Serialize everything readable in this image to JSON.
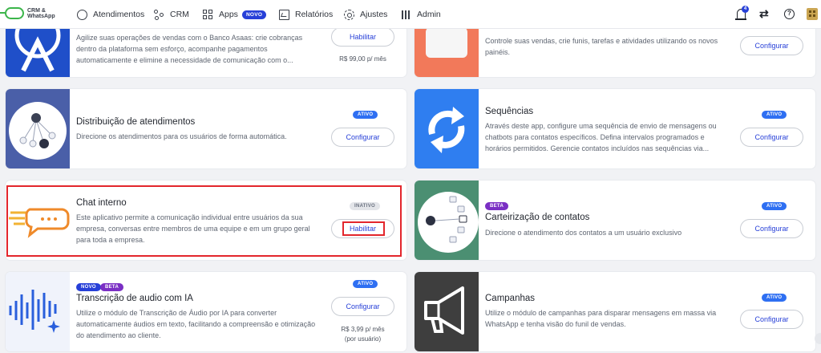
{
  "brand": {
    "logo_text": "CRM & WhatsApp"
  },
  "nav": {
    "atendimentos": "Atendimentos",
    "crm": "CRM",
    "apps": "Apps",
    "apps_badge": "NOVO",
    "relatorios": "Relatórios",
    "ajustes": "Ajustes",
    "admin": "Admin"
  },
  "header_icons": {
    "notifications_count": "4",
    "swap_glyph": "⇄",
    "help_glyph": "?"
  },
  "colors": {
    "brand_blue": "#2740d8",
    "active_blue": "#2e6ff2",
    "highlight_red": "#e3262c",
    "beta_purple": "#7a2fc4"
  },
  "cards": {
    "asaas": {
      "desc": "Agilize suas operações de vendas com o Banco Asaas: crie cobranças dentro da plataforma sem esforço, acompanhe pagamentos automaticamente e elimine a necessidade de comunicação com o...",
      "button": "Habilitar",
      "price": "R$ 99,00 p/ mês"
    },
    "funil": {
      "desc": "Controle suas vendas, crie funis, tarefas e atividades utilizando os novos painéis.",
      "button": "Configurar"
    },
    "distribuicao": {
      "title": "Distribuição de atendimentos",
      "desc": "Direcione os atendimentos para os usuários de forma automática.",
      "status": "ATIVO",
      "button": "Configurar"
    },
    "sequencias": {
      "title": "Sequências",
      "desc": "Através deste app, configure uma sequência de envio de mensagens ou chatbots para contatos específicos. Defina intervalos programados e horários permitidos. Gerencie contatos incluídos nas sequências via...",
      "status": "ATIVO",
      "button": "Configurar"
    },
    "chat_interno": {
      "title": "Chat interno",
      "desc": "Este aplicativo permite a comunicação individual entre usuários da sua empresa, conversas entre membros de uma equipe e em um grupo geral para toda a empresa.",
      "status": "INATIVO",
      "button": "Habilitar"
    },
    "carteirizacao": {
      "badge": "BETA",
      "title": "Carteirização de contatos",
      "desc": "Direcione o atendimento dos contatos a um usuário exclusivo",
      "status": "ATIVO",
      "button": "Configurar"
    },
    "transcricao": {
      "badge_novo": "NOVO",
      "badge_beta": "BETA",
      "title": "Transcrição de audio com IA",
      "desc": "Utilize o módulo de Transcrição de Áudio por IA para converter automaticamente áudios em texto, facilitando a compreensão e otimização do atendimento ao cliente.",
      "status": "ATIVO",
      "button": "Configurar",
      "price_line1": "R$ 3,99 p/ mês",
      "price_line2": "(por usuário)"
    },
    "campanhas": {
      "title": "Campanhas",
      "desc": "Utilize o módulo de campanhas para disparar mensagens em massa via WhatsApp e tenha visão do funil de vendas.",
      "status": "ATIVO",
      "button": "Configurar"
    }
  }
}
